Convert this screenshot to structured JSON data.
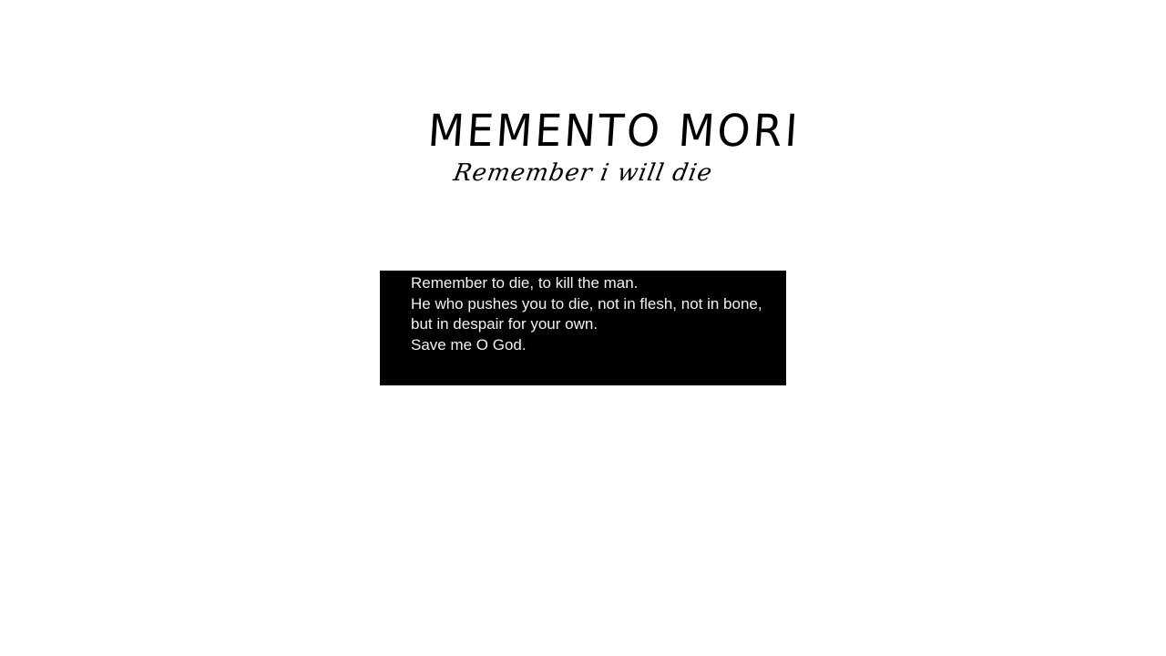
{
  "logo": {
    "title": "MEMENTO MORI",
    "subtitle": "Remember i will die"
  },
  "text_box": {
    "lines": [
      "Remember to die, to kill the man.",
      "He who pushes you to die, not in flesh, not in bone,",
      "but in despair for your own.",
      "Save me O God."
    ]
  },
  "colors": {
    "page_background": "#ffffff",
    "box_background": "#000000",
    "box_text": "#f2f2f2",
    "logo_text": "#000000"
  }
}
